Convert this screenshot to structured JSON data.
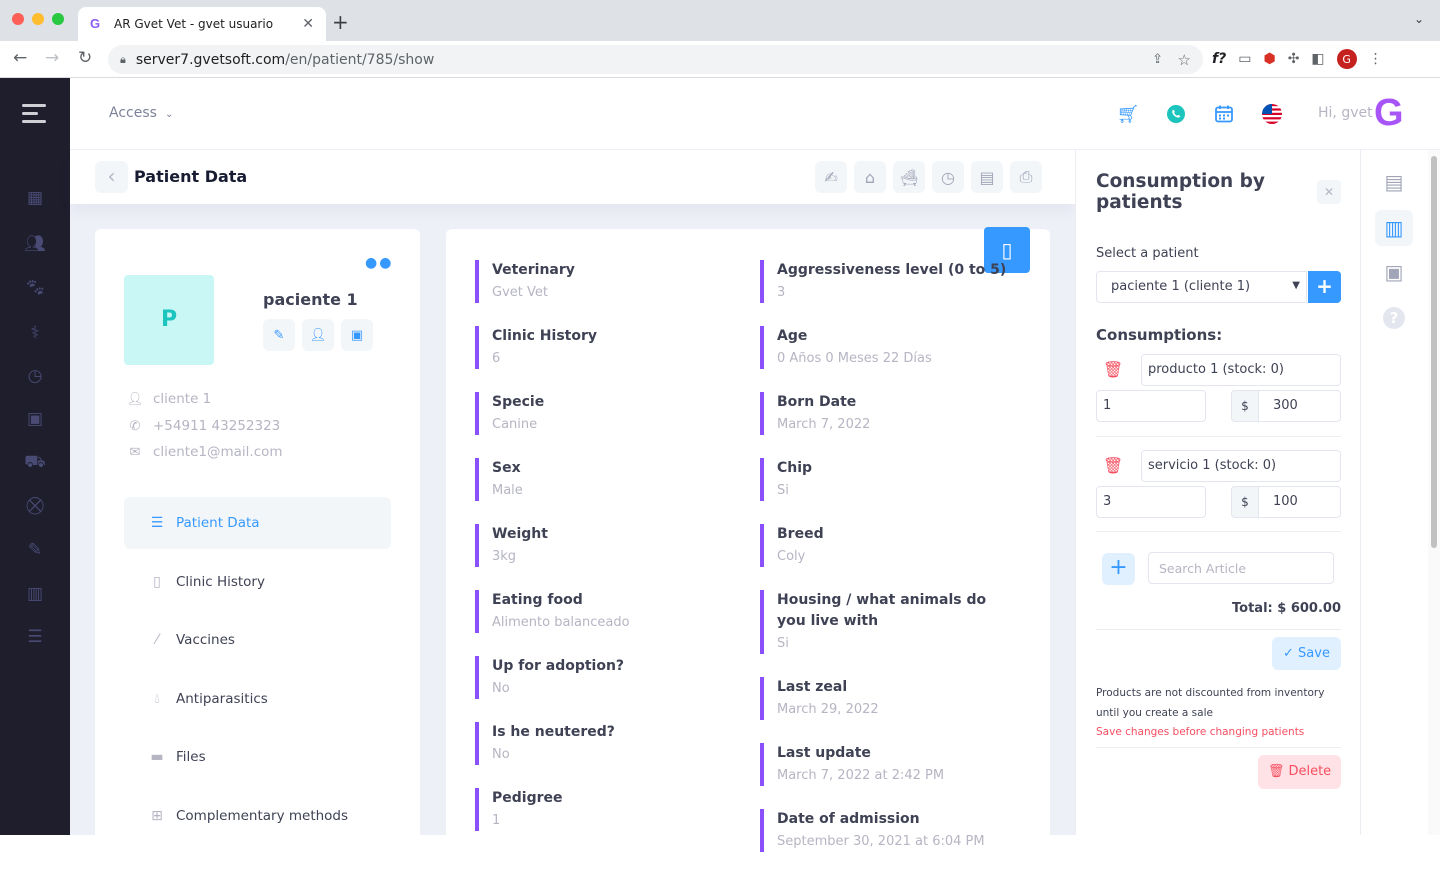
{
  "browser": {
    "tab_title": "AR Gvet Vet - gvet usuario",
    "url_host": "server7.gvetsoft.com",
    "url_path": "/en/patient/785/show",
    "profile_initial": "G"
  },
  "topbar": {
    "access_label": "Access",
    "greeting": "Hi, gvet",
    "logo_letter": "G"
  },
  "subheader": {
    "title": "Patient Data"
  },
  "patient": {
    "avatar_letter": "P",
    "name": "paciente 1",
    "owner": "cliente 1",
    "phone": "+54911 43252323",
    "email": "cliente1@mail.com"
  },
  "nav": [
    {
      "label": "Patient Data",
      "icon": "list-icon"
    },
    {
      "label": "Clinic History",
      "icon": "clipboard-icon"
    },
    {
      "label": "Vaccines",
      "icon": "syringe-icon"
    },
    {
      "label": "Antiparasitics",
      "icon": "drop-icon"
    },
    {
      "label": "Files",
      "icon": "folder-icon"
    },
    {
      "label": "Complementary methods",
      "icon": "plus-file-icon"
    }
  ],
  "fields_left": [
    {
      "label": "Veterinary",
      "value": "Gvet Vet"
    },
    {
      "label": "Clinic History",
      "value": "6"
    },
    {
      "label": "Specie",
      "value": "Canine"
    },
    {
      "label": "Sex",
      "value": "Male"
    },
    {
      "label": "Weight",
      "value": "3kg"
    },
    {
      "label": "Eating food",
      "value": "Alimento balanceado"
    },
    {
      "label": "Up for adoption?",
      "value": "No"
    },
    {
      "label": "Is he neutered?",
      "value": "No"
    },
    {
      "label": "Pedigree",
      "value": "1"
    }
  ],
  "fields_right": [
    {
      "label": "Aggressiveness level (0 to 5)",
      "value": "3"
    },
    {
      "label": "Age",
      "value": "0 Años 0 Meses 22 Días"
    },
    {
      "label": "Born Date",
      "value": "March 7, 2022"
    },
    {
      "label": "Chip",
      "value": "Si"
    },
    {
      "label": "Breed",
      "value": "Coly"
    },
    {
      "label": "Housing / what animals do you live with",
      "value": "Si"
    },
    {
      "label": "Last zeal",
      "value": "March 29, 2022"
    },
    {
      "label": "Last update",
      "value": "March 7, 2022 at 2:42 PM"
    },
    {
      "label": "Date of admission",
      "value": "September 30, 2021 at 6:04 PM"
    }
  ],
  "consumption": {
    "title": "Consumption by patients",
    "select_label": "Select a patient",
    "selected_patient": "paciente 1 (cliente 1)",
    "consumptions_label": "Consumptions:",
    "items": [
      {
        "name": "producto 1 (stock: 0)",
        "qty": "1",
        "currency": "$",
        "price": "300"
      },
      {
        "name": "servicio 1 (stock: 0)",
        "qty": "3",
        "currency": "$",
        "price": "100"
      }
    ],
    "search_placeholder": "Search Article",
    "total": "Total: $ 600.00",
    "save_label": "Save",
    "note": "Products are not discounted from inventory until you create a sale",
    "warning": "Save changes before changing patients",
    "delete_label": "Delete"
  },
  "colors": {
    "accent": "#3699ff",
    "field_bar": "#8950fc",
    "danger": "#f64e60",
    "sidebar": "#1e1e2d"
  }
}
